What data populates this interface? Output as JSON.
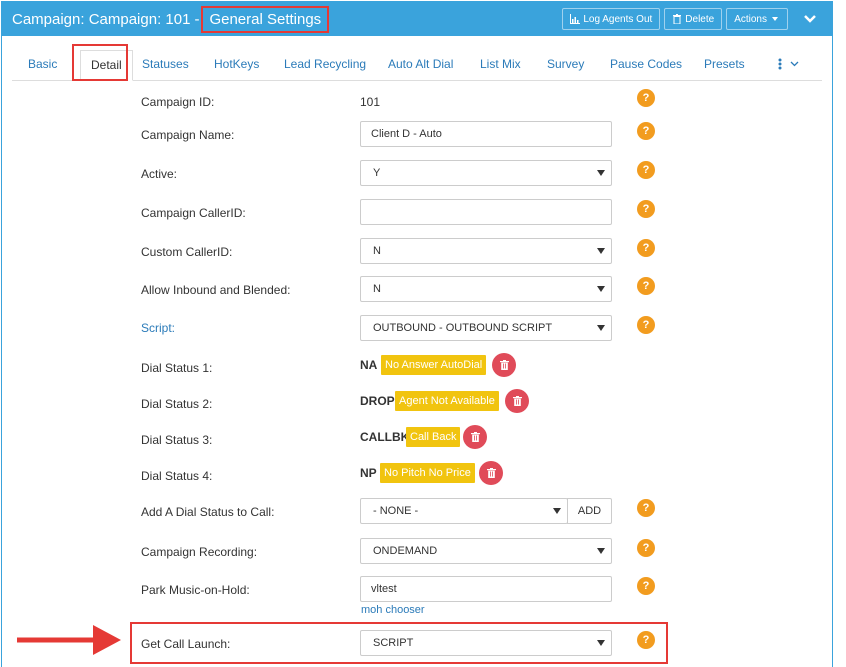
{
  "header": {
    "title_prefix": "Campaign: Campaign: 101",
    "title_sep": "-",
    "title_section": "General Settings",
    "log_agents_out": "Log Agents Out",
    "delete": "Delete",
    "actions": "Actions"
  },
  "tabs": [
    "Basic",
    "Detail",
    "Statuses",
    "HotKeys",
    "Lead Recycling",
    "Auto Alt Dial",
    "List Mix",
    "Survey",
    "Pause Codes",
    "Presets"
  ],
  "active_tab": "Detail",
  "form": {
    "campaign_id": {
      "label": "Campaign ID:",
      "value": "101"
    },
    "campaign_name": {
      "label": "Campaign Name:",
      "value": "Client D - Auto"
    },
    "active": {
      "label": "Active:",
      "value": "Y"
    },
    "campaign_callerid": {
      "label": "Campaign CallerID:",
      "value": ""
    },
    "custom_callerid": {
      "label": "Custom CallerID:",
      "value": "N"
    },
    "allow_inbound": {
      "label": "Allow Inbound and Blended:",
      "value": "N"
    },
    "script": {
      "label": "Script:",
      "value": "OUTBOUND - OUTBOUND SCRIPT"
    },
    "dial_statuses": [
      {
        "label": "Dial Status 1:",
        "code": "NA",
        "desc": "No Answer AutoDial"
      },
      {
        "label": "Dial Status 2:",
        "code": "DROP",
        "desc": "Agent Not Available"
      },
      {
        "label": "Dial Status 3:",
        "code": "CALLBK",
        "desc": "Call Back"
      },
      {
        "label": "Dial Status 4:",
        "code": "NP",
        "desc": "No Pitch No Price"
      }
    ],
    "add_dial_status": {
      "label": "Add A Dial Status to Call:",
      "value": "- NONE -",
      "button": "ADD"
    },
    "campaign_recording": {
      "label": "Campaign Recording:",
      "value": "ONDEMAND"
    },
    "park_moh": {
      "label": "Park Music-on-Hold:",
      "value": "vltest",
      "link": "moh chooser"
    },
    "get_call_launch": {
      "label": "Get Call Launch:",
      "value": "SCRIPT"
    }
  },
  "help_glyph": "?",
  "colors": {
    "header_bg": "#3aa3dc",
    "help": "#f29c1f",
    "badge": "#f1c40f",
    "trash": "#e04b59",
    "highlight": "#e53935"
  }
}
